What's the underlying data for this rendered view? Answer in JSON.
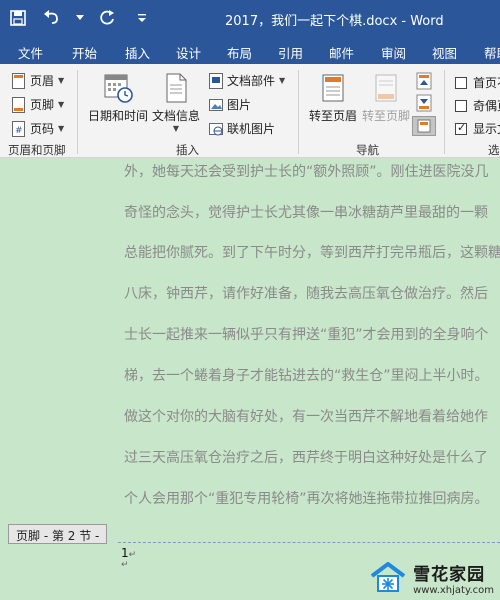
{
  "window": {
    "title": "2017，我们一起下个棋.docx  -  Word"
  },
  "tabs": [
    "文件",
    "开始",
    "插入",
    "设计",
    "布局",
    "引用",
    "邮件",
    "审阅",
    "视图",
    "帮助"
  ],
  "ribbon": {
    "header_footer": {
      "header": "页眉",
      "footer": "页脚",
      "page_number": "页码",
      "label": "页眉和页脚"
    },
    "insert": {
      "date_time": "日期和时间",
      "doc_info": "文档信息",
      "doc_parts": "文档部件",
      "picture": "图片",
      "online_picture": "联机图片",
      "label": "插入"
    },
    "navigation": {
      "goto_header": "转至页眉",
      "goto_footer": "转至页脚",
      "label": "导航"
    },
    "options": {
      "first_page": "首页不",
      "odd_even": "奇偶页",
      "show_doc": "显示文",
      "label": "选",
      "first_page_checked": false,
      "odd_even_checked": false,
      "show_doc_checked": true
    }
  },
  "document": {
    "lines": [
      "外，她每天还会受到护士长的“额外照顾”。刚住进医院没几",
      "奇怪的念头，觉得护士长尤其像一串冰糖葫芦里最甜的一颗",
      "总能把你腻死。到了下午时分，等到西芹打完吊瓶后，这颗糖",
      "八床，钟西芹，请作好准备，随我去高压氧仓做治疗。然后",
      "士长一起推来一辆似乎只有押送“重犯”才会用到的全身响个",
      "梯，去一个蜷着身子才能钻进去的“救生仓”里闷上半小时。",
      "做这个对你的大脑有好处，有一次当西芹不解地看着给她作",
      "过三天高压氧仓治疗之后，西芹终于明白这种好处是什么了",
      "个人会用那个“重犯专用轮椅”再次将她连拖带拉推回病房。"
    ],
    "footer_tag": "页脚 - 第 2 节 -",
    "page_number": "1",
    "para_mark": "↵"
  },
  "watermark": {
    "cn": "雪花家园",
    "en": "www.xhjaty.com"
  },
  "colors": {
    "brand": "#2b579a",
    "doc_bg": "#c8e6c9",
    "ribbon_bg": "#f3f3f3"
  }
}
